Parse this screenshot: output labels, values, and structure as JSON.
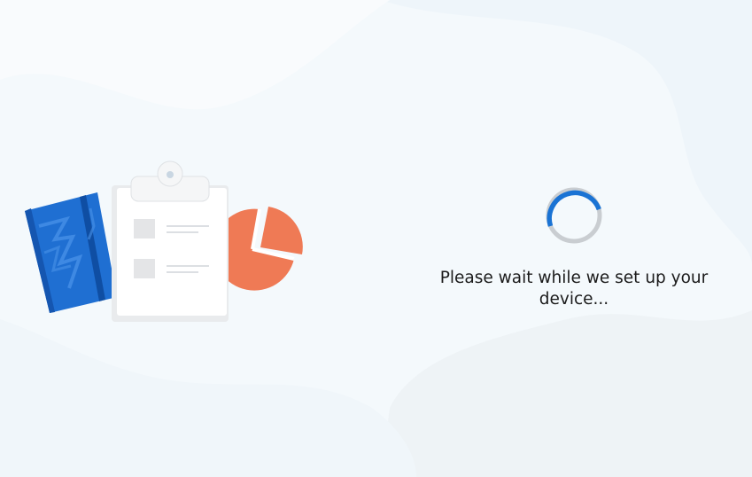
{
  "setup": {
    "status_message": "Please wait while we set up your device..."
  },
  "icons": {
    "illustration": "office-apps-illustration",
    "notebook": "notebook-icon",
    "clipboard": "clipboard-icon",
    "pie_chart": "pie-chart-icon",
    "spinner": "loading-spinner-icon"
  },
  "colors": {
    "background": "#f4f9fc",
    "spinner_active": "#1a73d4",
    "spinner_track": "#c9cdd1",
    "notebook": "#1f6fd2",
    "pie_chart": "#ef7a55",
    "text": "#1b1b1b"
  }
}
